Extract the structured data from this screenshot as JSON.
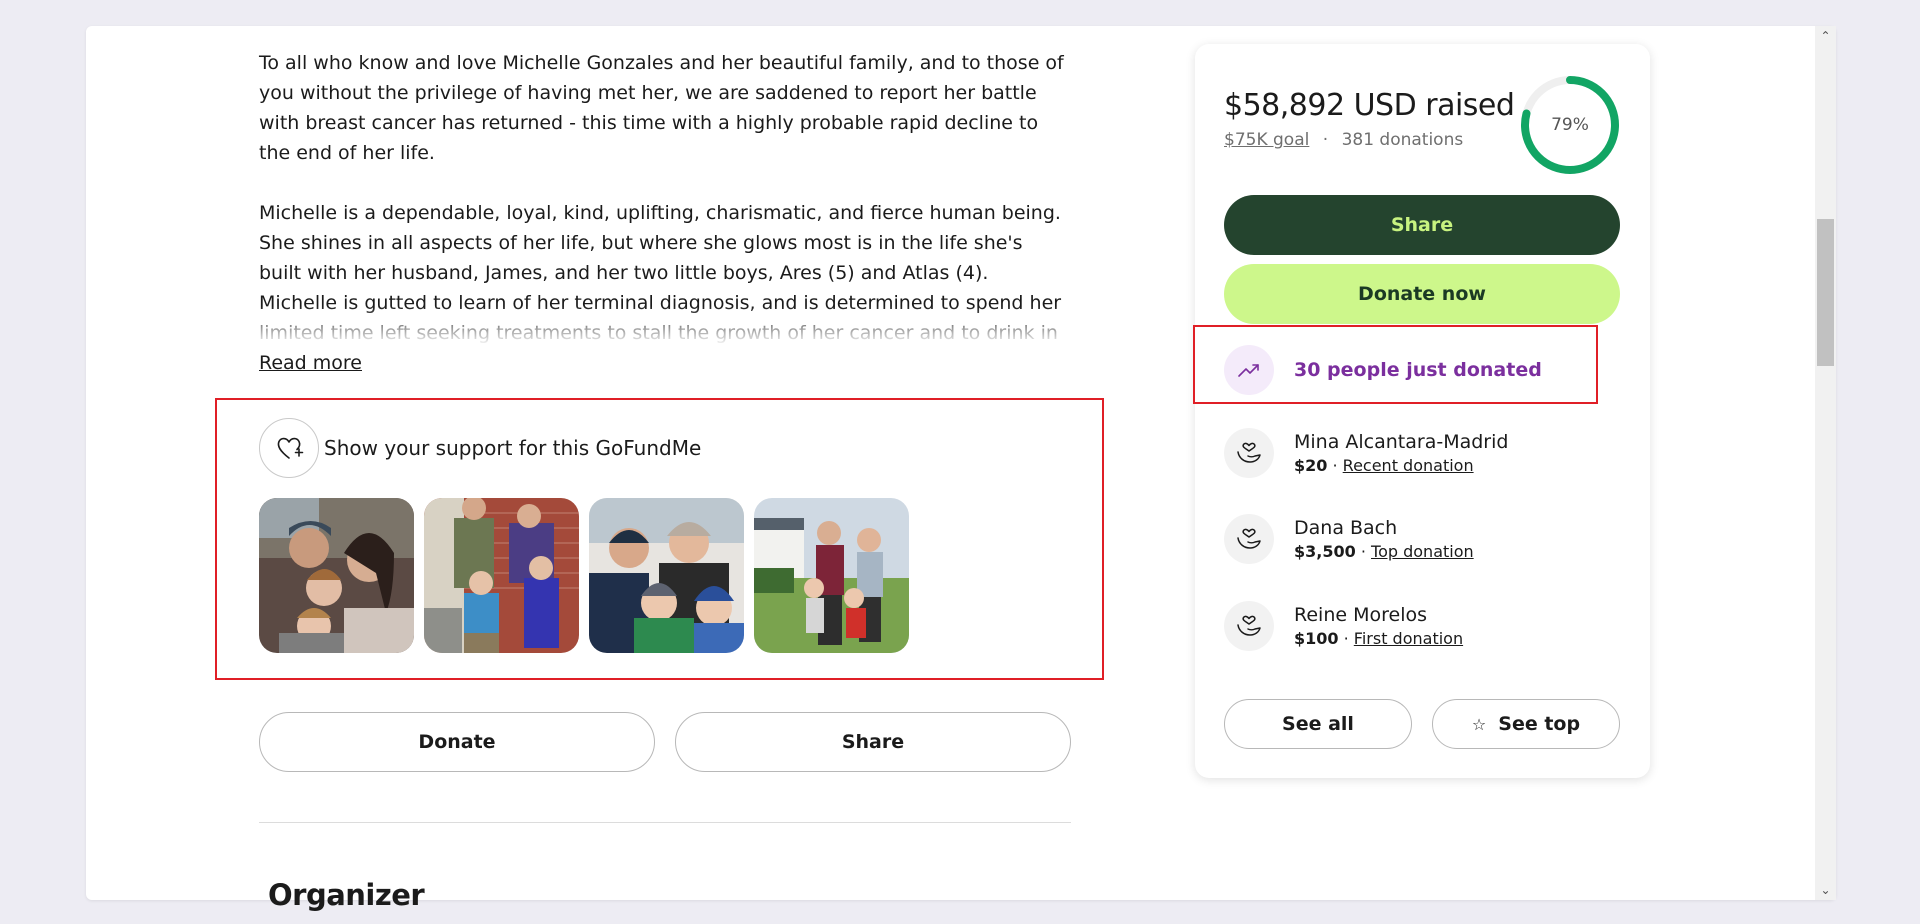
{
  "story": {
    "paragraph1": "To all who know and love Michelle Gonzales and her beautiful family, and to those of you without the privilege of having met her, we are saddened to report her battle with breast cancer has returned - this time with a highly probable rapid decline to the end of her life.",
    "paragraph2": "Michelle is a dependable, loyal, kind, uplifting, charismatic, and fierce human being. She shines in all aspects of her life, but where she glows most is in the life she's built with her husband, James, and her two little boys, Ares (5) and Atlas (4). Michelle is gutted to learn of her terminal diagnosis, and is determined to spend her limited time left seeking treatments to stall the growth of her cancer and to drink in as much time as she possibly",
    "read_more": "Read more"
  },
  "support": {
    "title": "Show your support for this GoFundMe",
    "icon": "heart-plus-icon",
    "photos": [
      "family-photo-1",
      "family-photo-2",
      "family-photo-3",
      "family-photo-4"
    ]
  },
  "actions": {
    "donate_label": "Donate",
    "share_label": "Share"
  },
  "organizer_heading": "Organizer",
  "donation_card": {
    "raised": "$58,892 USD raised",
    "goal": "$75K goal",
    "separator": "·",
    "donations": "381 donations",
    "progress_percent": 79,
    "progress_label": "79%",
    "share_label": "Share",
    "donate_now_label": "Donate now",
    "trend_text": "30 people just donated",
    "donors": [
      {
        "name": "Mina Alcantara-Madrid",
        "amount": "$20",
        "kind": "Recent donation"
      },
      {
        "name": "Dana Bach",
        "amount": "$3,500",
        "kind": "Top donation"
      },
      {
        "name": "Reine Morelos",
        "amount": "$100",
        "kind": "First donation"
      }
    ],
    "see_all_label": "See all",
    "see_top_label": "See top"
  },
  "colors": {
    "share_bg": "#24442e",
    "share_text": "#c8f380",
    "donate_now_bg": "#cdf78b",
    "progress": "#12a564",
    "trend_purple": "#7b2f9e",
    "highlight_red": "#e01f26"
  }
}
